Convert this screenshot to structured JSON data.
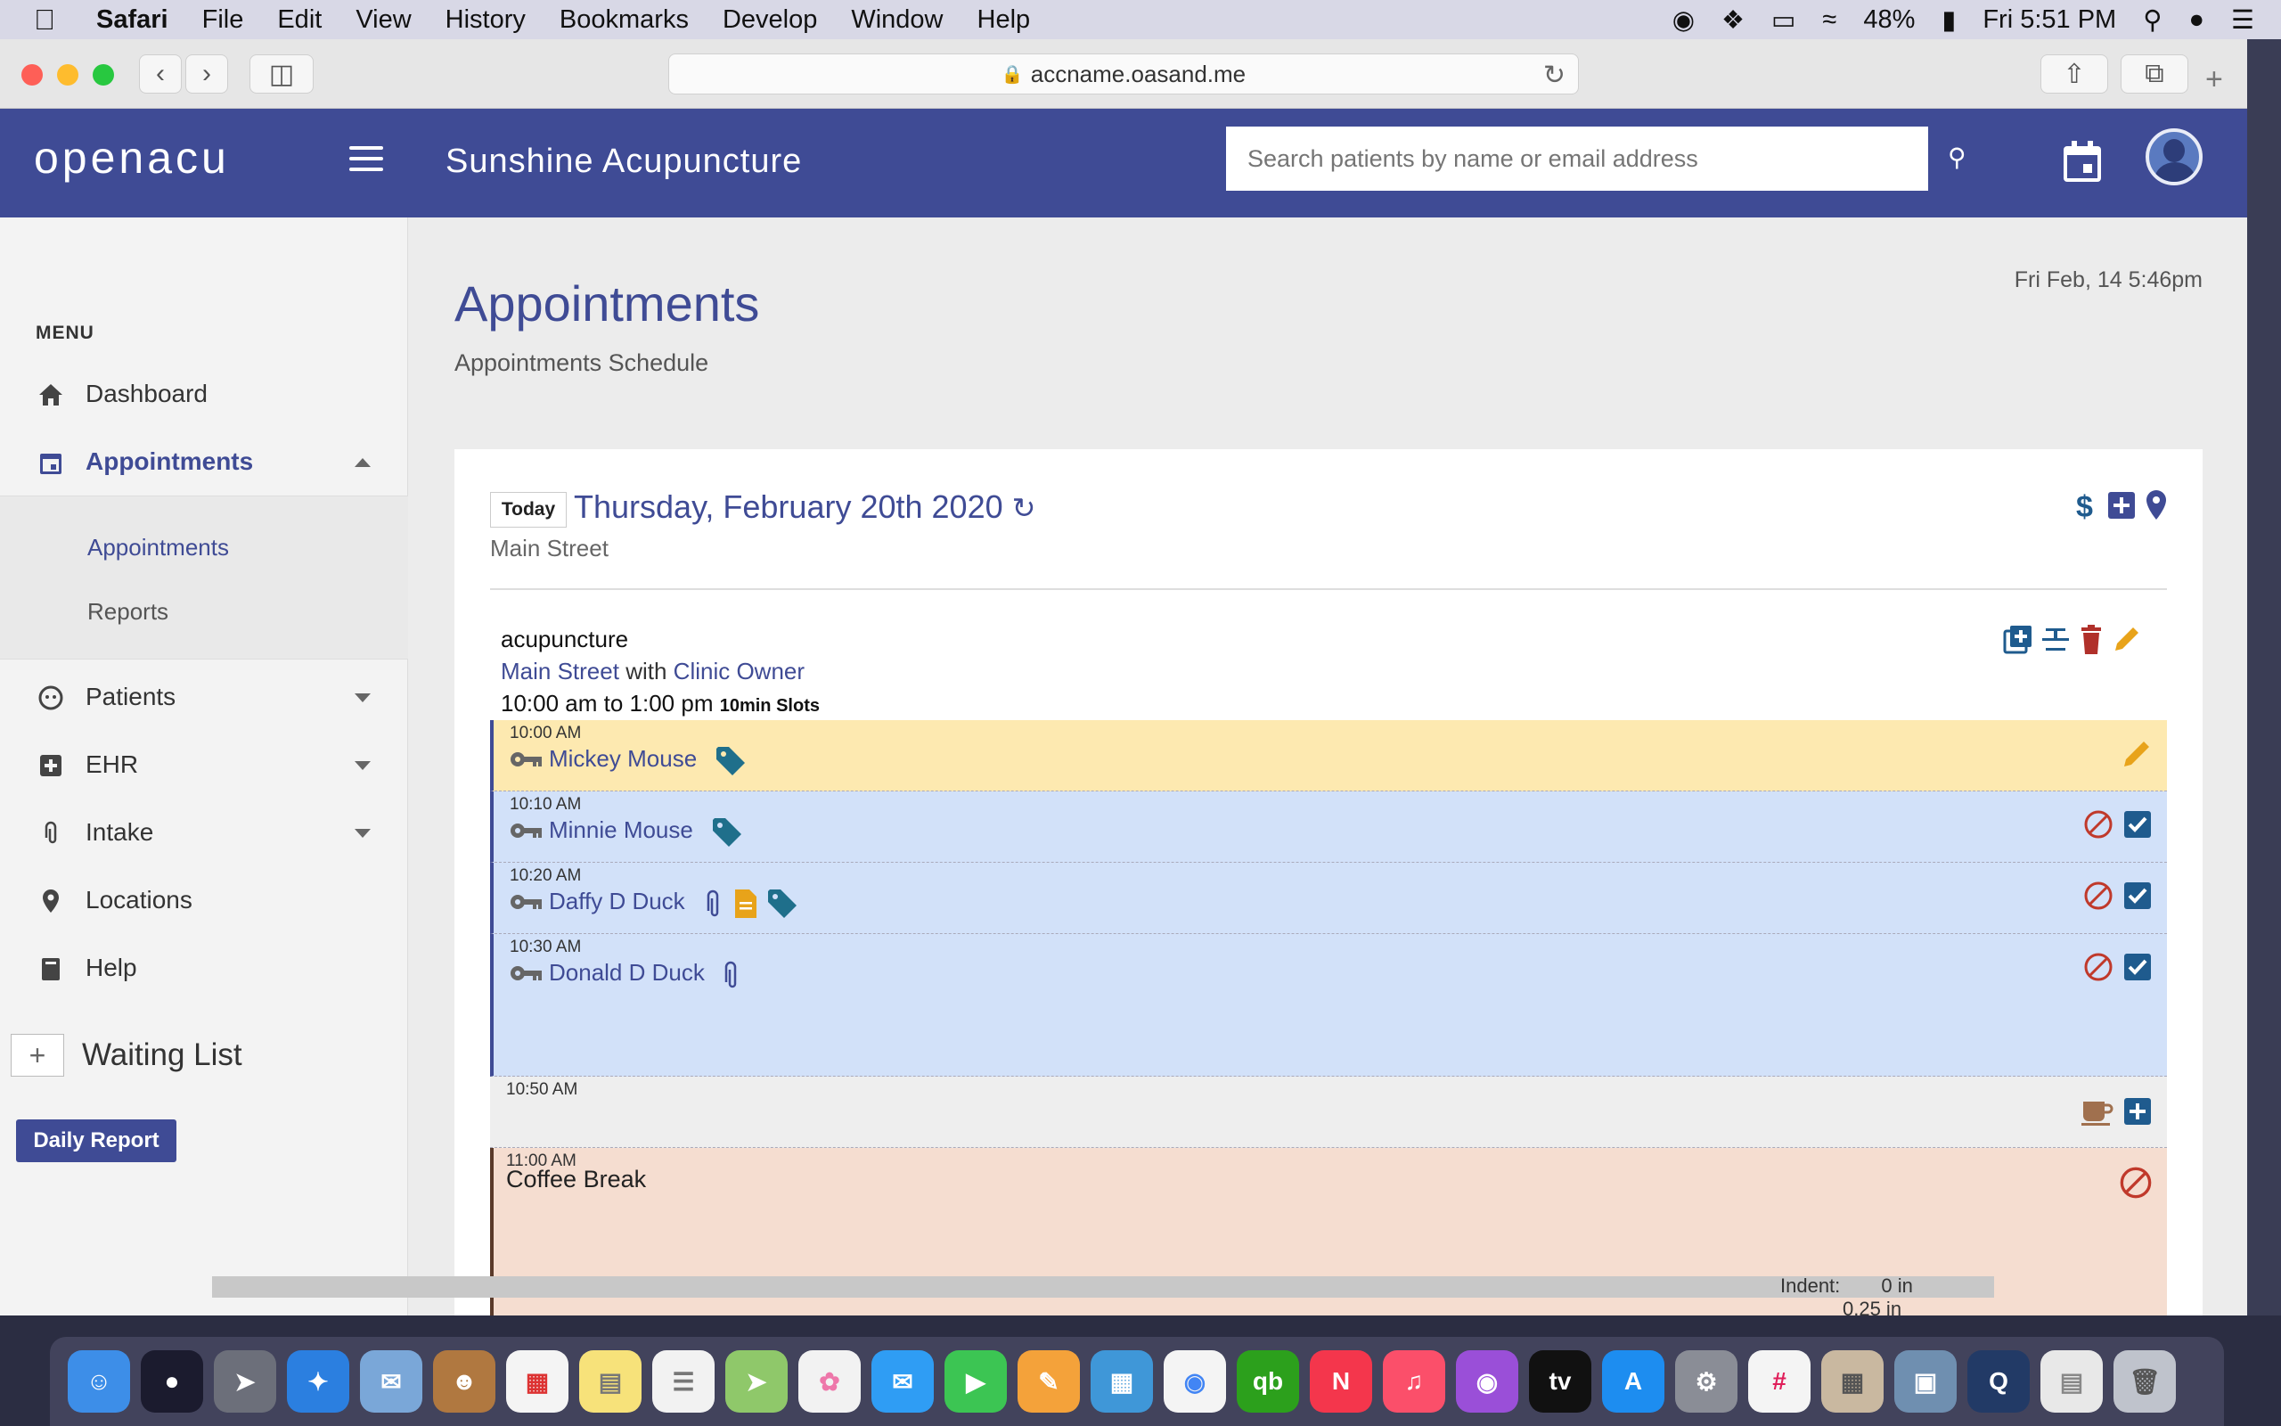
{
  "menubar": {
    "app": "Safari",
    "items": [
      "File",
      "Edit",
      "View",
      "History",
      "Bookmarks",
      "Develop",
      "Window",
      "Help"
    ],
    "battery": "48%",
    "clock": "Fri 5:51 PM"
  },
  "browser": {
    "url": "accname.oasand.me"
  },
  "header": {
    "logo": "openacu",
    "clinic": "Sunshine Acupuncture",
    "search_placeholder": "Search patients by name or email address"
  },
  "sidebar": {
    "menu_label": "MENU",
    "items": [
      {
        "label": "Dashboard",
        "icon": "home-icon"
      },
      {
        "label": "Appointments",
        "icon": "calendar-icon"
      },
      {
        "label": "Patients",
        "icon": "face-icon"
      },
      {
        "label": "EHR",
        "icon": "medical-plus-icon"
      },
      {
        "label": "Intake",
        "icon": "paperclip-icon"
      },
      {
        "label": "Locations",
        "icon": "map-pin-icon"
      },
      {
        "label": "Help",
        "icon": "book-icon"
      }
    ],
    "sub_items": [
      "Appointments",
      "Reports"
    ],
    "waiting_list": "Waiting List",
    "waiting_plus": "+",
    "daily_report": "Daily Report"
  },
  "main": {
    "title": "Appointments",
    "subtitle": "Appointments Schedule",
    "datetime": "Fri Feb, 14 5:46pm",
    "today_button": "Today",
    "current_date": "Thursday, February 20th 2020",
    "location": "Main Street",
    "block": {
      "title": "acupuncture",
      "location": "Main Street",
      "with": "with",
      "practitioner": "Clinic Owner",
      "hours": "10:00 am to 1:00 pm",
      "slot_size": "10min Slots"
    },
    "slots": [
      {
        "time": "10:00 AM",
        "patient": "Mickey Mouse"
      },
      {
        "time": "10:10 AM",
        "patient": "Minnie Mouse"
      },
      {
        "time": "10:20 AM",
        "patient": "Daffy D Duck"
      },
      {
        "time": "10:30 AM",
        "patient": "Donald D Duck"
      },
      {
        "time": "10:50 AM",
        "patient": ""
      },
      {
        "time": "11:00 AM",
        "patient": "Coffee Break"
      }
    ]
  },
  "bottom": {
    "indent_label": "Indent:",
    "indent_value": "0 in",
    "spacing_value": "0.25 in"
  },
  "colors": {
    "brand": "#3f4b95",
    "yellow_slot": "#fde9b0",
    "blue_slot": "#d2e1f9",
    "peach_slot": "#f5ddd0",
    "cancel_red": "#c0392b",
    "check_blue": "#1f5b8e",
    "tag_teal": "#1f6f8b"
  }
}
